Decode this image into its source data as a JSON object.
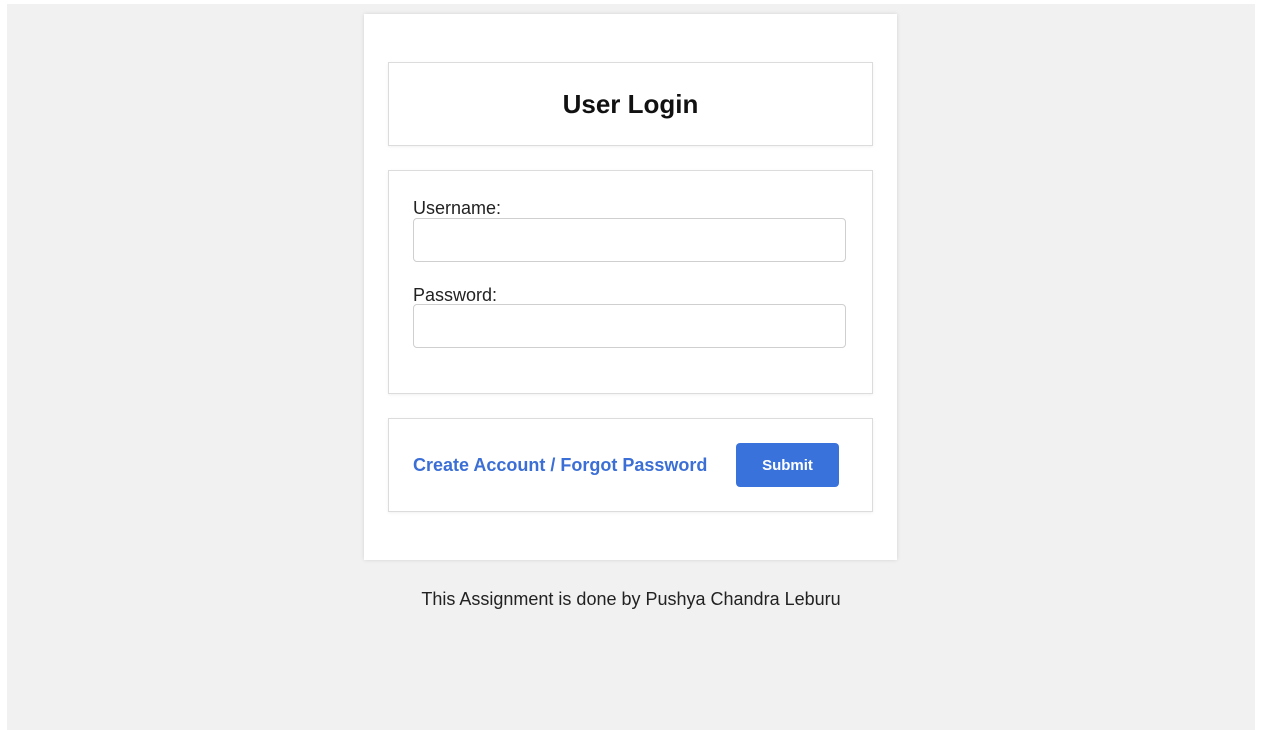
{
  "login": {
    "title": "User Login",
    "username_label": "Username:",
    "username_value": "",
    "password_label": "Password:",
    "password_value": "",
    "link_text": "Create Account / Forgot Password",
    "submit_label": "Submit"
  },
  "footer": {
    "text": "This Assignment is done by Pushya Chandra Leburu"
  },
  "colors": {
    "background": "#f1f1f1",
    "accent": "#3a72dc",
    "link": "#3b6fd6"
  }
}
